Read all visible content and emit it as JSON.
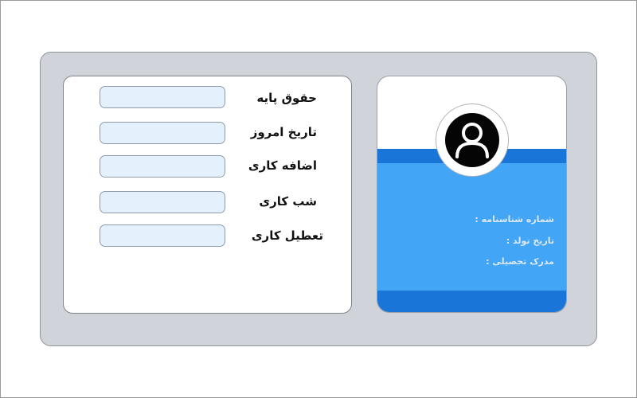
{
  "form": {
    "fields": [
      {
        "label": "حقوق پایه",
        "value": ""
      },
      {
        "label": "تاریخ امروز",
        "value": ""
      },
      {
        "label": "اضافه کاری",
        "value": ""
      },
      {
        "label": "شب کاری",
        "value": ""
      },
      {
        "label": "تعطیل کاری",
        "value": ""
      }
    ]
  },
  "profile": {
    "avatar_icon": "user-circle-icon",
    "info": [
      {
        "label": "شماره شناسنامه :"
      },
      {
        "label": "تاریخ تولد :"
      },
      {
        "label": "مدرک تحصیلی :"
      }
    ]
  },
  "colors": {
    "panel": "#d0d4da",
    "card_blue": "#42a5f5",
    "card_band": "#1976d8",
    "input_fill": "#e4f0fc"
  }
}
